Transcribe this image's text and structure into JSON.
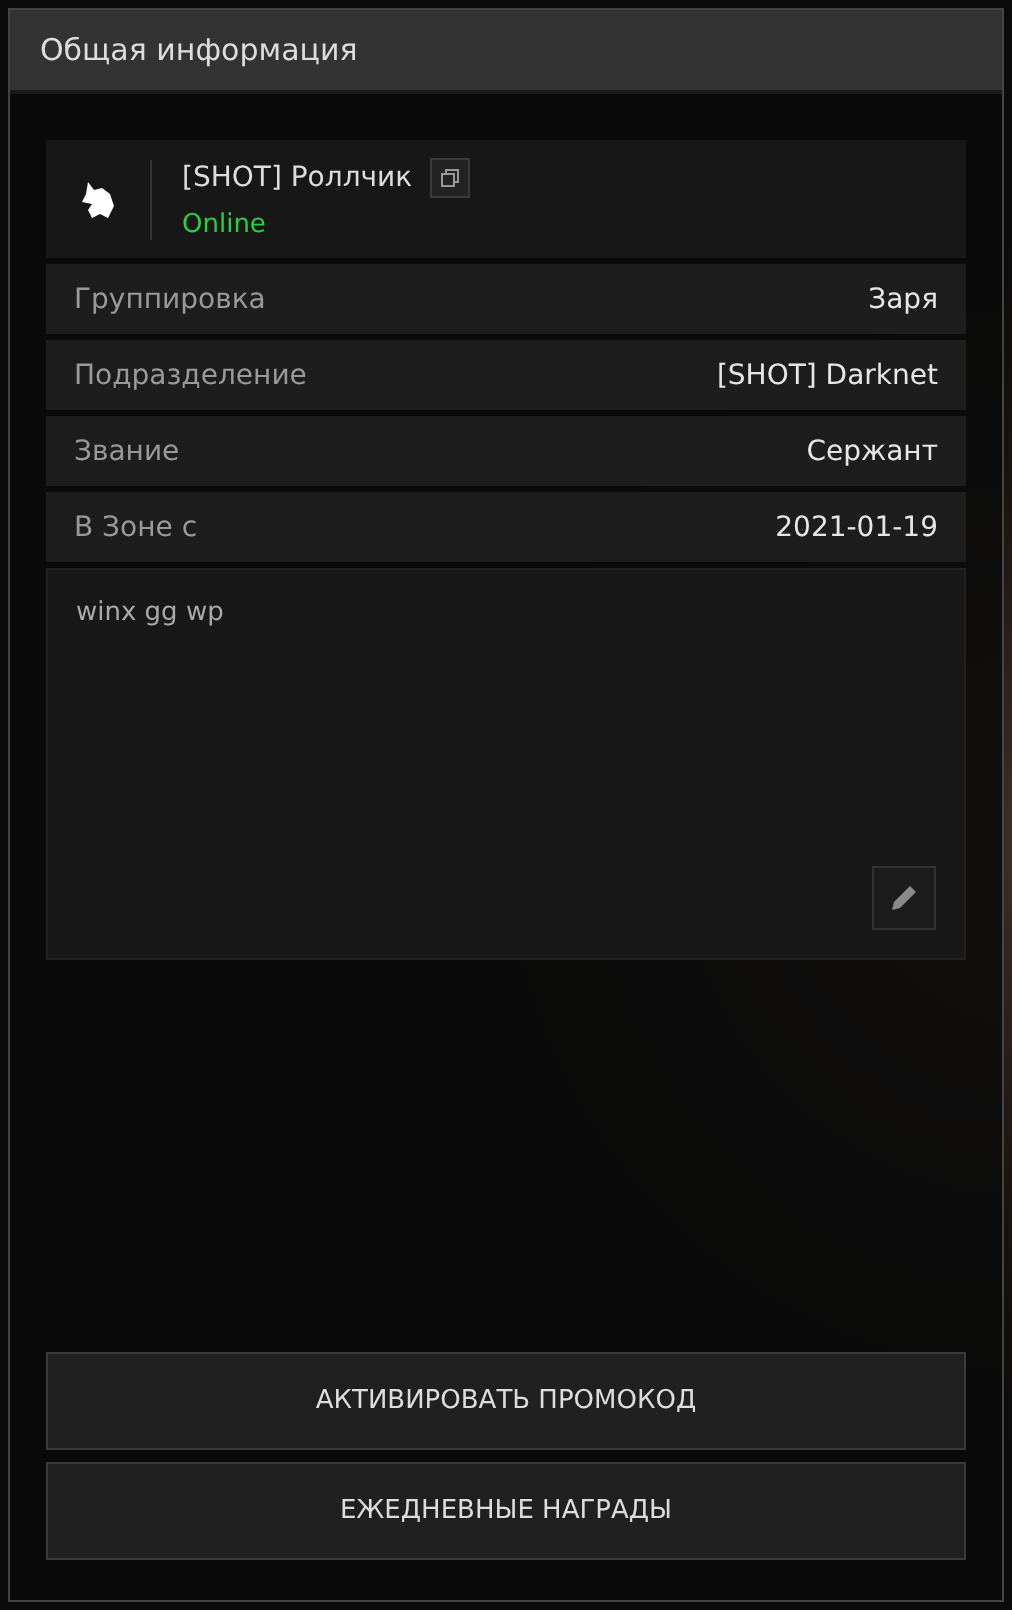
{
  "panel": {
    "title": "Общая информация"
  },
  "profile": {
    "name": "[SHOT] Роллчик",
    "status": "Online",
    "online": true
  },
  "fields": [
    {
      "label": "Группировка",
      "value": "Заря"
    },
    {
      "label": "Подразделение",
      "value": "[SHOT] Darknet"
    },
    {
      "label": "Звание",
      "value": "Сержант"
    },
    {
      "label": "В Зоне с",
      "value": "2021-01-19"
    }
  ],
  "note": {
    "text": "winx gg wp"
  },
  "buttons": [
    "АКТИВИРОВАТЬ ПРОМОКОД",
    "ЕЖЕДНЕВНЫЕ НАГРАДЫ"
  ]
}
